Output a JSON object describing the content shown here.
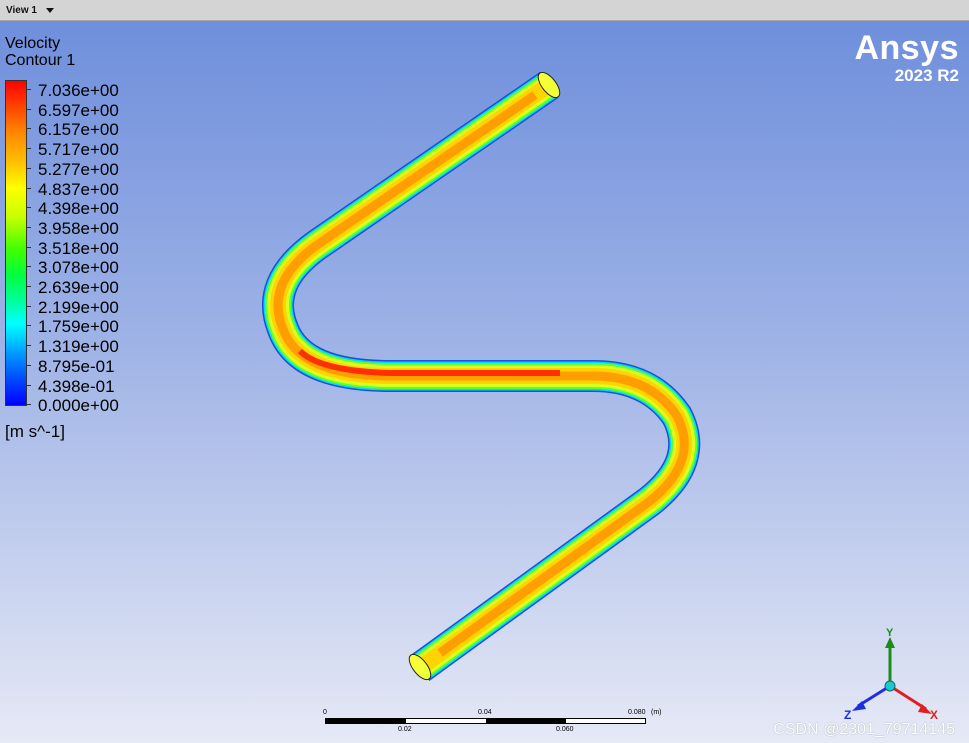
{
  "view_tab": {
    "label": "View 1"
  },
  "legend": {
    "title_line1": "Velocity",
    "title_line2": "Contour 1",
    "levels": [
      "7.036e+00",
      "6.597e+00",
      "6.157e+00",
      "5.717e+00",
      "5.277e+00",
      "4.837e+00",
      "4.398e+00",
      "3.958e+00",
      "3.518e+00",
      "3.078e+00",
      "2.639e+00",
      "2.199e+00",
      "1.759e+00",
      "1.319e+00",
      "8.795e-01",
      "4.398e-01",
      "0.000e+00"
    ],
    "units": "[m s^-1]"
  },
  "logo": {
    "name": "Ansys",
    "version": "2023 R2"
  },
  "scale_bar": {
    "top_labels": [
      "0",
      "0.04",
      "0.080"
    ],
    "unit": "(m)",
    "bottom_labels": [
      "0.02",
      "0.060"
    ]
  },
  "triad": {
    "y": "Y",
    "z": "Z",
    "x": "X",
    "colors": {
      "y": "#1a8c1a",
      "z": "#1e2ee0",
      "x": "#e02020"
    }
  },
  "watermark": "CSDN @2301_79714145"
}
